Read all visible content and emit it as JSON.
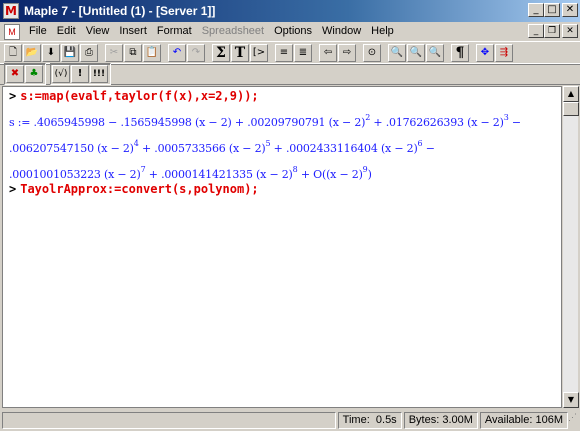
{
  "window": {
    "title": "Maple 7 - [Untitled (1) - [Server 1]]",
    "app_icon_glyph": "M",
    "minimize_glyph": "_",
    "maximize_glyph": "□",
    "close_glyph": "✕"
  },
  "menubar": {
    "items": [
      {
        "label": "File",
        "disabled": false
      },
      {
        "label": "Edit",
        "disabled": false
      },
      {
        "label": "View",
        "disabled": false
      },
      {
        "label": "Insert",
        "disabled": false
      },
      {
        "label": "Format",
        "disabled": false
      },
      {
        "label": "Spreadsheet",
        "disabled": true
      },
      {
        "label": "Options",
        "disabled": false
      },
      {
        "label": "Window",
        "disabled": false
      },
      {
        "label": "Help",
        "disabled": false
      }
    ],
    "doc_minimize_glyph": "_",
    "doc_restore_glyph": "❐",
    "doc_close_glyph": "✕"
  },
  "toolbar1": {
    "buttons": [
      {
        "name": "new-icon",
        "glyph": "🗋"
      },
      {
        "name": "open-icon",
        "glyph": "📂"
      },
      {
        "name": "open-url-icon",
        "glyph": "⬇"
      },
      {
        "name": "save-icon",
        "glyph": "💾"
      },
      {
        "name": "print-icon",
        "glyph": "⎙"
      },
      {
        "name": "cut-icon",
        "glyph": "✂"
      },
      {
        "name": "copy-icon",
        "glyph": "⧉"
      },
      {
        "name": "paste-icon",
        "glyph": "📋"
      },
      {
        "name": "undo-icon",
        "glyph": "↶"
      },
      {
        "name": "redo-icon",
        "glyph": "↷"
      },
      {
        "name": "math-input-icon",
        "glyph": "Σ"
      },
      {
        "name": "text-input-icon",
        "glyph": "T"
      },
      {
        "name": "insert-prompt-icon",
        "glyph": "[>"
      },
      {
        "name": "remove-section-icon",
        "glyph": "≡"
      },
      {
        "name": "add-section-icon",
        "glyph": "≣"
      },
      {
        "name": "back-icon",
        "glyph": "⇦"
      },
      {
        "name": "forward-icon",
        "glyph": "⇨"
      },
      {
        "name": "stop-icon",
        "glyph": "⊙"
      },
      {
        "name": "zoom-100-icon",
        "glyph": "🔍"
      },
      {
        "name": "zoom-150-icon",
        "glyph": "🔍"
      },
      {
        "name": "zoom-200-icon",
        "glyph": "🔍"
      },
      {
        "name": "show-nonprinting-icon",
        "glyph": "¶"
      },
      {
        "name": "restart-icon",
        "glyph": "✥"
      },
      {
        "name": "execute-all-icon",
        "glyph": "⇶"
      }
    ]
  },
  "toolbar2": {
    "buttons": [
      {
        "name": "stop-exec-icon",
        "glyph": "✖"
      },
      {
        "name": "maple-leaf-icon",
        "glyph": "♣"
      },
      {
        "name": "check-syntax-icon",
        "glyph": "(√)"
      },
      {
        "name": "execute-icon",
        "glyph": "!"
      },
      {
        "name": "execute-worksheet-icon",
        "glyph": "!!!"
      }
    ]
  },
  "worksheet": {
    "prompt": ">",
    "command1": "s:=map(evalf,taylor(f(x),x=2,9));",
    "output_line1": "s := .4065945998 − .1565945998 (x − 2) + .00209790791 (x − 2)",
    "output_line1_exp": "2",
    "output_line1_b": " + .01762626393 (x − 2)",
    "output_line1_exp2": "3",
    "output_line1_c": " −",
    "output_line2_a": ".006207547150 (x − 2)",
    "output_line2_exp1": "4",
    "output_line2_b": " + .0005733566 (x − 2)",
    "output_line2_exp2": "5",
    "output_line2_c": " + .0002433116404 (x − 2)",
    "output_line2_exp3": "6",
    "output_line2_d": " −",
    "output_line3_a": ".0001001053223 (x − 2)",
    "output_line3_exp1": "7",
    "output_line3_b": " + .0000141421335 (x − 2)",
    "output_line3_exp2": "8",
    "output_line3_c": " + O((x − 2)",
    "output_line3_exp3": "9",
    "output_line3_d": ")",
    "command2": "TayolrApprox:=convert(s,polynom);"
  },
  "statusbar": {
    "time_label": "Time:",
    "time_value": "0.5s",
    "bytes_label": "Bytes:",
    "bytes_value": "3.00M",
    "available_label": "Available:",
    "available_value": "106M"
  },
  "colors": {
    "input_text": "#e00000",
    "output_text": "#2020ff",
    "titlebar_start": "#0a246a"
  }
}
